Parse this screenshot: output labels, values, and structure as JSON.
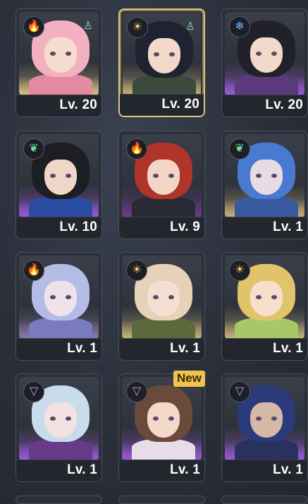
{
  "roster": [
    {
      "level": "Lv. 20",
      "element": "fire",
      "role": "support",
      "hair": "#f2b0c0",
      "skin": "#f6dccf",
      "glow": "#d9c080",
      "outfit": "#e48aa0",
      "selected": false
    },
    {
      "level": "Lv. 20",
      "element": "light",
      "role": "support",
      "hair": "#1f2230",
      "skin": "#f1d8c8",
      "glow": "#c8b27a",
      "outfit": "#3b4a3a",
      "selected": true
    },
    {
      "level": "Lv. 20",
      "element": "ice",
      "role": "",
      "hair": "#22202a",
      "skin": "#f2dacb",
      "glow": "#9a5ad8",
      "outfit": "#5a3a7a",
      "selected": false
    },
    {
      "level": "Lv. 10",
      "element": "wind",
      "role": "",
      "hair": "#1d1d24",
      "skin": "#f0d6c6",
      "glow": "#9a5ad8",
      "outfit": "#2a4ca0",
      "selected": false
    },
    {
      "level": "Lv. 9",
      "element": "fire",
      "role": "",
      "hair": "#b03428",
      "skin": "#f3d6c5",
      "glow": "#6a3a8a",
      "outfit": "#2a2a34",
      "selected": false
    },
    {
      "level": "Lv. 1",
      "element": "wind",
      "role": "",
      "hair": "#4a7ad0",
      "skin": "#e8dce4",
      "glow": "#c8b27a",
      "outfit": "#3a5aa0",
      "selected": false
    },
    {
      "level": "Lv. 1",
      "element": "fire",
      "role": "",
      "hair": "#b4bce6",
      "skin": "#f0e2ea",
      "glow": "#8a7aa8",
      "outfit": "#7a7ac0",
      "selected": false
    },
    {
      "level": "Lv. 1",
      "element": "light",
      "role": "",
      "hair": "#e6d2b8",
      "skin": "#f4dfd2",
      "glow": "#c8b27a",
      "outfit": "#5a6a3a",
      "selected": false
    },
    {
      "level": "Lv. 1",
      "element": "light",
      "role": "",
      "hair": "#e0c36a",
      "skin": "#f6e0cc",
      "glow": "#c8b27a",
      "outfit": "#a8c868",
      "selected": false
    },
    {
      "level": "Lv. 1",
      "element": "void",
      "role": "",
      "hair": "#c8dcec",
      "skin": "#f2e2e2",
      "glow": "#9a5ad8",
      "outfit": "#6a3a8a",
      "selected": false
    },
    {
      "level": "Lv. 1",
      "element": "void",
      "role": "",
      "hair": "#6a4a3a",
      "skin": "#f4d8ca",
      "glow": "#9a5ad8",
      "outfit": "#e8dce8",
      "selected": false,
      "badge": "New"
    },
    {
      "level": "Lv. 1",
      "element": "void",
      "role": "",
      "hair": "#2a3a7a",
      "skin": "#d6b8a6",
      "glow": "#9a5ad8",
      "outfit": "#2a3060",
      "selected": false
    }
  ],
  "element_glyphs": {
    "fire": "🔥",
    "light": "☀",
    "ice": "❄",
    "wind": "❦",
    "void": "▽"
  },
  "element_colors": {
    "fire": "#ff6a3a",
    "light": "#ffd45a",
    "ice": "#6ab8ff",
    "wind": "#6ae0a0",
    "void": "#c09aff"
  },
  "role_glyphs": {
    "support": "♙"
  }
}
